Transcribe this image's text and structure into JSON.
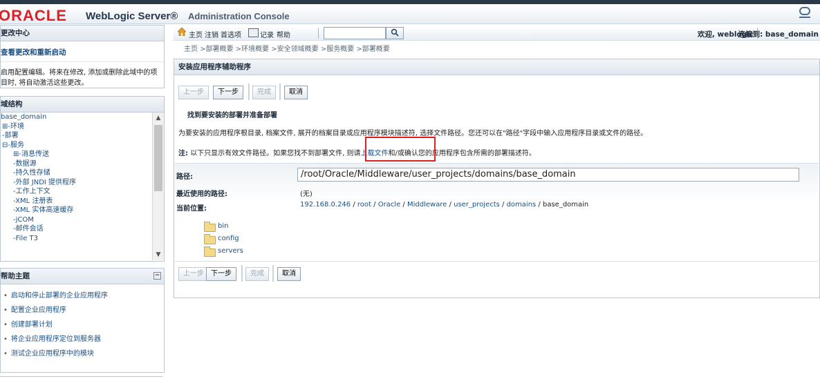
{
  "banner": {
    "oracle": "ORACLE",
    "product": "WebLogic Server®",
    "subtitle": "Administration Console"
  },
  "change_center": {
    "title": "更改中心",
    "link": "查看更改和重新启动",
    "text": "启用配置编辑。将来在修改, 添加或删除此域中的项目时, 将自动激活这些更改。"
  },
  "domain_structure": {
    "title": "域结构",
    "items": [
      {
        "label": "base_domain",
        "depth": 0
      },
      {
        "label": "⊞-环境",
        "depth": 1
      },
      {
        "label": "-部署",
        "depth": 1
      },
      {
        "label": "⊟-服务",
        "depth": 1
      },
      {
        "label": "⊞-消息传送",
        "depth": 2
      },
      {
        "label": "-数据源",
        "depth": 2
      },
      {
        "label": "-持久性存储",
        "depth": 2
      },
      {
        "label": "-外部 JNDI 提供程序",
        "depth": 2
      },
      {
        "label": "-工作上下文",
        "depth": 2
      },
      {
        "label": "-XML 注册表",
        "depth": 2
      },
      {
        "label": "-XML 实体高速缓存",
        "depth": 2
      },
      {
        "label": "-jCOM",
        "depth": 2
      },
      {
        "label": "-邮件会话",
        "depth": 2
      },
      {
        "label": "-File T3",
        "depth": 2
      }
    ]
  },
  "help": {
    "title": "帮助主题",
    "items": [
      "启动和停止部署的企业应用程序",
      "配置企业应用程序",
      "创建部署计划",
      "将企业应用程序定位到服务器",
      "测试企业应用程序中的模块"
    ]
  },
  "toolbar": {
    "home": "主页",
    "logout": "注销",
    "preferences": "首选项",
    "record": "记录",
    "help": "帮助",
    "search_value": "",
    "welcome": "欢迎, weblogic",
    "connected": "连接到: base_domain"
  },
  "breadcrumb": "主页 >部署概要 >环境概要 >安全领域概要 >服务概要 >部署概要",
  "assistant": {
    "title": "安装应用程序辅助程序",
    "buttons": {
      "back": "上一步",
      "next": "下一步",
      "finish": "完成",
      "cancel": "取消"
    },
    "section_title": "找到要安装的部署并准备部署",
    "description": "为要安装的应用程序根目录, 档案文件, 展开的档案目录或应用程序模块描述符, 选择文件路径。您还可以在\"路径\"字段中输入应用程序目录或文件的路径。",
    "note_label": "注:",
    "note_text": "以下只显示有效文件路径。如果您找不到部署文件, 则请",
    "note_link": "上载文件",
    "note_tail": "和/或确认您的应用程序包含所需的部署描述符。",
    "path_label": "路径:",
    "path_value": "/root/Oracle/Middleware/user_projects/domains/base_domain",
    "recent_label": "最近使用的路径:",
    "recent_value": "(无)",
    "current_label": "当前位置:",
    "current_parts": [
      "192.168.0.246",
      "root",
      "Oracle",
      "Middleware",
      "user_projects",
      "domains"
    ],
    "current_last": "base_domain",
    "folders": [
      "bin",
      "config",
      "servers"
    ]
  }
}
